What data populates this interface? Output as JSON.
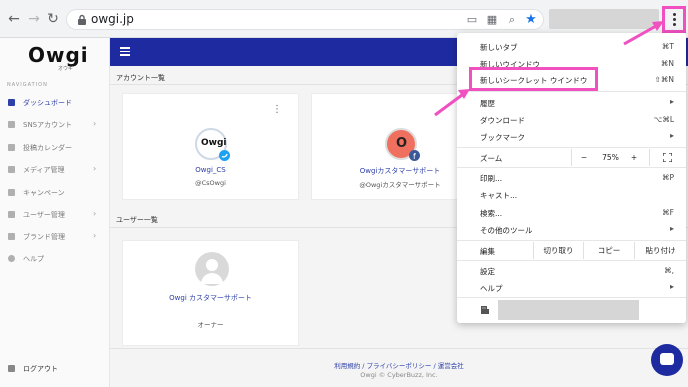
{
  "browser": {
    "url": "owgi.jp",
    "back_icon": "back-arrow-icon",
    "forward_icon": "forward-arrow-icon",
    "reload_icon": "reload-icon"
  },
  "sidebar": {
    "logo_text": "Owgi",
    "logo_sub": "オウギ",
    "nav_title": "NAVIGATION",
    "items": [
      {
        "label": "ダッシュボード",
        "icon": "dashboard-icon",
        "active": true,
        "chevron": false
      },
      {
        "label": "SNSアカウント",
        "icon": "sns-icon",
        "chevron": true
      },
      {
        "label": "投稿カレンダー",
        "icon": "calendar-icon",
        "chevron": false
      },
      {
        "label": "メディア管理",
        "icon": "media-icon",
        "chevron": true
      },
      {
        "label": "キャンペーン",
        "icon": "campaign-icon",
        "chevron": false
      },
      {
        "label": "ユーザー管理",
        "icon": "user-icon",
        "chevron": true
      },
      {
        "label": "ブランド管理",
        "icon": "brand-icon",
        "chevron": true
      },
      {
        "label": "ヘルプ",
        "icon": "help-icon",
        "chevron": false
      }
    ],
    "logout": "ログアウト"
  },
  "main": {
    "accounts_title": "アカウント一覧",
    "users_title": "ユーザー一覧",
    "accounts": [
      {
        "name": "Owgi_CS",
        "handle": "@CsOwgi",
        "network": "twitter"
      },
      {
        "name": "Owgiカスタマーサポート",
        "handle": "@Owgiカスタマーサポート",
        "network": "facebook"
      }
    ],
    "user": {
      "name": "Owgi カスタマーサポート",
      "role": "オーナー"
    },
    "footer_links": "利用規約 / プライバシーポリシー / 運営会社",
    "footer_copy": "Owgi © CyberBuzz, Inc."
  },
  "menu": {
    "new_tab": {
      "label": "新しいタブ",
      "shortcut": "⌘T"
    },
    "new_window": {
      "label": "新しいウインドウ",
      "shortcut": "⌘N"
    },
    "incognito": {
      "label": "新しいシークレット ウインドウ",
      "shortcut": "⇧⌘N"
    },
    "history": {
      "label": "履歴"
    },
    "downloads": {
      "label": "ダウンロード",
      "shortcut": "⌥⌘L"
    },
    "bookmarks": {
      "label": "ブックマーク"
    },
    "zoom": {
      "label": "ズーム",
      "minus": "−",
      "value": "75%",
      "plus": "+"
    },
    "print": {
      "label": "印刷...",
      "shortcut": "⌘P"
    },
    "cast": {
      "label": "キャスト..."
    },
    "find": {
      "label": "検索...",
      "shortcut": "⌘F"
    },
    "more_tools": {
      "label": "その他のツール"
    },
    "edit": {
      "label": "編集",
      "cut": "切り取り",
      "copy": "コピー",
      "paste": "貼り付け"
    },
    "settings": {
      "label": "設定",
      "shortcut": "⌘,"
    },
    "help": {
      "label": "ヘルプ"
    }
  },
  "colors": {
    "highlight": "#f050c0",
    "header": "#1e2aa0",
    "accent": "#2d3fa8"
  }
}
